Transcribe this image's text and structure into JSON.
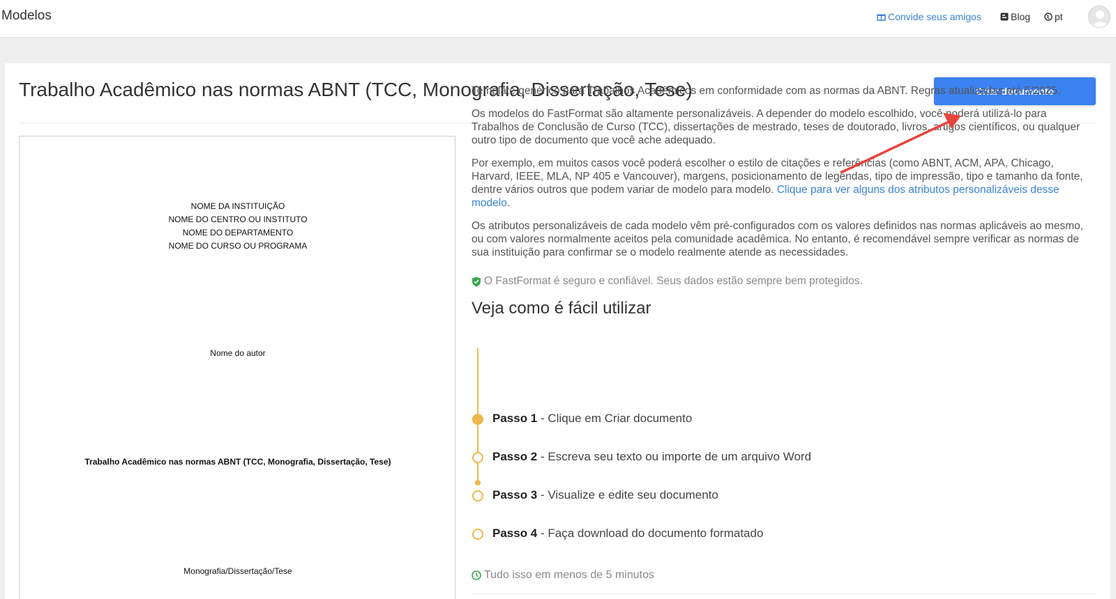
{
  "navbar": {
    "brand": "Modelos",
    "invite_label": "Convide seus amigos",
    "blog_label": "Blog",
    "lang_label": "pt"
  },
  "colors": {
    "accent": "#3b82f0",
    "link": "#3b82d6",
    "timeline": "#f1b74a",
    "secure_icon": "#3aa64e",
    "annotation_arrow": "#e8453c"
  },
  "template": {
    "title": "Trabalho Acadêmico nas normas ABNT (TCC, Monografia, Dissertação, Tese)",
    "create_button": "Criar documento"
  },
  "preview": {
    "institution_lines": [
      "NOME DA INSTITUIÇÃO",
      "NOME DO CENTRO OU INSTITUTO",
      "NOME DO DEPARTAMENTO",
      "NOME DO CURSO OU PROGRAMA"
    ],
    "author": "Nome do autor",
    "title": "Trabalho Acadêmico nas normas ABNT (TCC, Monografia, Dissertação, Tese)",
    "doc_type": "Monografia/Dissertação/Tese"
  },
  "description": {
    "p1": "Template genérico para Trabalhos Acadêmicos em conformidade com as normas da ABNT. Regras atualizadas até 5/2025.",
    "p2": "Os modelos do FastFormat são altamente personalizáveis. A depender do modelo escolhido, você poderá utilizá-lo para Trabalhos de Conclusão de Curso (TCC), dissertações de mestrado, teses de doutorado, livros, artigos científicos, ou qualquer outro tipo de documento que você ache adequado.",
    "p3": "Por exemplo, em muitos casos você poderá escolher o estilo de citações e referências (como ABNT, ACM, APA, Chicago, Harvard, IEEE, MLA, NP 405 e Vancouver), margens, posicionamento de legendas, tipo de impressão, tipo e tamanho da fonte, dentre vários outros que podem variar de modelo para modelo. ",
    "p3_link": "Clique para ver alguns dos atributos personalizáveis desse modelo",
    "p3_end": ".",
    "p4": "Os atributos personalizáveis de cada modelo vêm pré-configurados com os valores definidos nas normas aplicáveis ao mesmo, ou com valores normalmente aceitos pela comunidade acadêmica. No entanto, é recomendável sempre verificar as normas de sua instituição para confirmar se o modelo realmente atende as necessidades."
  },
  "secure_note": "O FastFormat é seguro e confiável. Seus dados estão sempre bem protegidos.",
  "how_to": {
    "title": "Veja como é fácil utilizar",
    "steps": [
      {
        "label": "Passo 1",
        "text": " - Clique em Criar documento"
      },
      {
        "label": "Passo 2",
        "text": " - Escreva seu texto ou importe de um arquivo Word"
      },
      {
        "label": "Passo 3",
        "text": " - Visualize e edite seu documento"
      },
      {
        "label": "Passo 4",
        "text": " - Faça download do documento formatado"
      }
    ],
    "duration": "Tudo isso em menos de 5 minutos"
  }
}
